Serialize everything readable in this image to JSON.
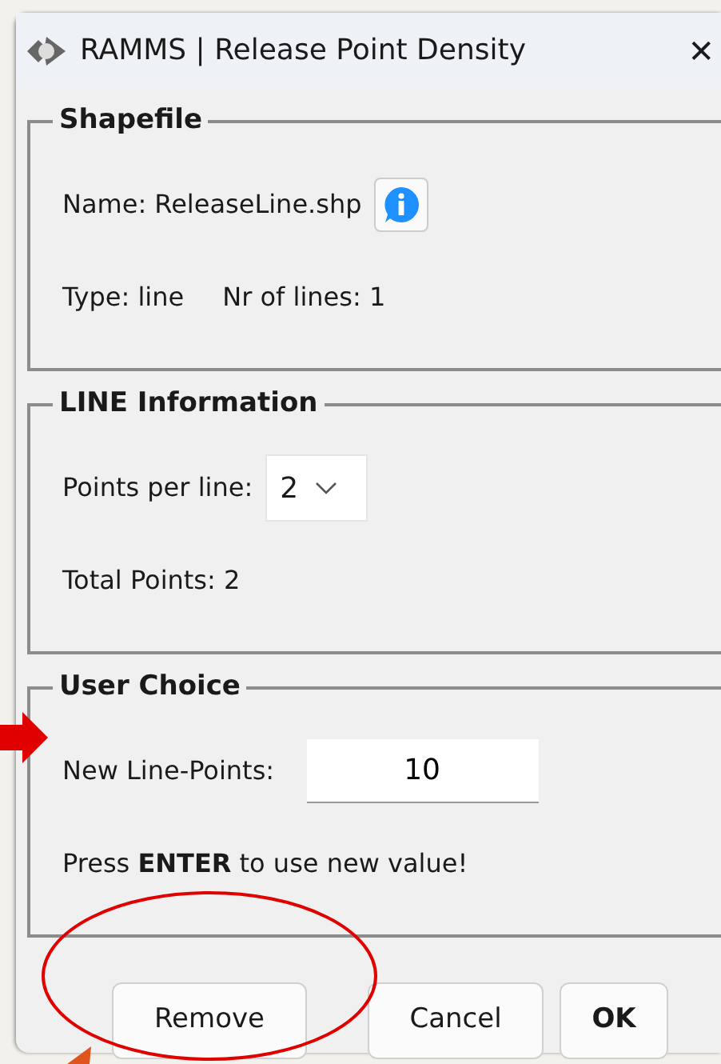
{
  "window": {
    "title": "RAMMS | Release Point Density",
    "close": "✕"
  },
  "groups": [
    {
      "title": "Shapefile",
      "rows": [
        {
          "kind": "name",
          "label": "Name: ReleaseLine.shp"
        },
        {
          "kind": "pair",
          "label": "Type: line",
          "value": "Nr of lines: 1"
        }
      ]
    },
    {
      "title": "LINE Information",
      "rows": [
        {
          "kind": "select",
          "label": "Points per line:",
          "value": "2"
        },
        {
          "kind": "text",
          "label": "Total Points: 2"
        }
      ]
    },
    {
      "title": "User Choice",
      "rows": [
        {
          "kind": "input",
          "label": "New Line-Points:",
          "value": "10"
        },
        {
          "kind": "text",
          "label": "Press **ENTER** to use new value!"
        }
      ]
    }
  ],
  "buttons": [
    {
      "label": "Remove",
      "bold": false
    },
    {
      "label": "Cancel",
      "bold": false
    },
    {
      "label": "OK",
      "bold": true
    }
  ],
  "annotations": [
    {
      "kind": "arrow",
      "color": "#e00000"
    },
    {
      "kind": "ellipse",
      "color": "#e00000"
    },
    {
      "kind": "pointer",
      "color": "#e0551e"
    }
  ]
}
